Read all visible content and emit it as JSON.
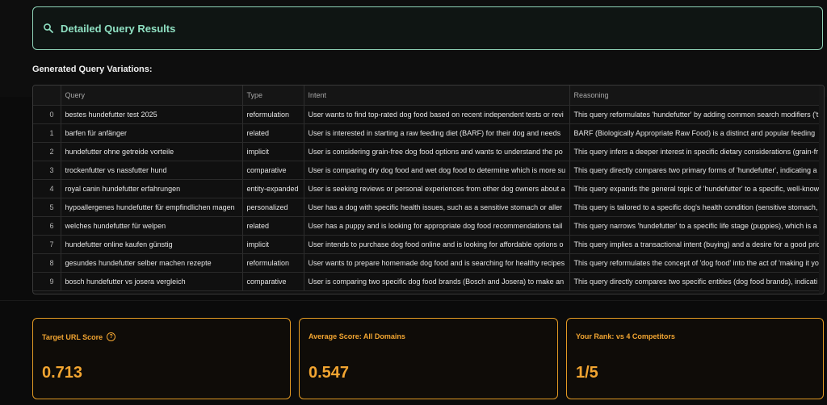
{
  "header": {
    "title": "Detailed Query Results",
    "icon": "search-icon"
  },
  "section_title": "Generated Query Variations:",
  "table": {
    "columns": [
      "",
      "Query",
      "Type",
      "Intent",
      "Reasoning"
    ],
    "rows": [
      {
        "idx": "0",
        "query": "bestes hundefutter test 2025",
        "type": "reformulation",
        "intent": "User wants to find top-rated dog food based on recent independent tests or revi",
        "reasoning": "This query reformulates 'hundefutter' by adding common search modifiers ('t"
      },
      {
        "idx": "1",
        "query": "barfen für anfänger",
        "type": "related",
        "intent": "User is interested in starting a raw feeding diet (BARF) for their dog and needs",
        "reasoning": "BARF (Biologically Appropriate Raw Food) is a distinct and popular feeding"
      },
      {
        "idx": "2",
        "query": "hundefutter ohne getreide vorteile",
        "type": "implicit",
        "intent": "User is considering grain-free dog food options and wants to understand the po",
        "reasoning": "This query infers a deeper interest in specific dietary considerations (grain-fr"
      },
      {
        "idx": "3",
        "query": "trockenfutter vs nassfutter hund",
        "type": "comparative",
        "intent": "User is comparing dry dog food and wet dog food to determine which is more su",
        "reasoning": "This query directly compares two primary forms of 'hundefutter', indicating a"
      },
      {
        "idx": "4",
        "query": "royal canin hundefutter erfahrungen",
        "type": "entity-expanded",
        "intent": "User is seeking reviews or personal experiences from other dog owners about a",
        "reasoning": "This query expands the general topic of 'hundefutter' to a specific, well-know"
      },
      {
        "idx": "5",
        "query": "hypoallergenes hundefutter für empfindlichen magen",
        "type": "personalized",
        "intent": "User has a dog with specific health issues, such as a sensitive stomach or aller",
        "reasoning": "This query is tailored to a specific dog's health condition (sensitive stomach,"
      },
      {
        "idx": "6",
        "query": "welches hundefutter für welpen",
        "type": "related",
        "intent": "User has a puppy and is looking for appropriate dog food recommendations tail",
        "reasoning": "This query narrows 'hundefutter' to a specific life stage (puppies), which is a"
      },
      {
        "idx": "7",
        "query": "hundefutter online kaufen günstig",
        "type": "implicit",
        "intent": "User intends to purchase dog food online and is looking for affordable options o",
        "reasoning": "This query implies a transactional intent (buying) and a desire for a good pric"
      },
      {
        "idx": "8",
        "query": "gesundes hundefutter selber machen rezepte",
        "type": "reformulation",
        "intent": "User wants to prepare homemade dog food and is searching for healthy recipes",
        "reasoning": "This query reformulates the concept of 'dog food' into the act of 'making it yo"
      },
      {
        "idx": "9",
        "query": "bosch hundefutter vs josera vergleich",
        "type": "comparative",
        "intent": "User is comparing two specific dog food brands (Bosch and Josera) to make an",
        "reasoning": "This query directly compares two specific entities (dog food brands), indicati"
      }
    ]
  },
  "metrics": [
    {
      "label": "Target URL Score",
      "value": "0.713",
      "has_help": true
    },
    {
      "label": "Average Score: All Domains",
      "value": "0.547",
      "has_help": false
    },
    {
      "label": "Your Rank: vs 4 Competitors",
      "value": "1/5",
      "has_help": false
    }
  ],
  "colors": {
    "accent_green": "#8fe0c2",
    "accent_orange": "#f2a531"
  }
}
